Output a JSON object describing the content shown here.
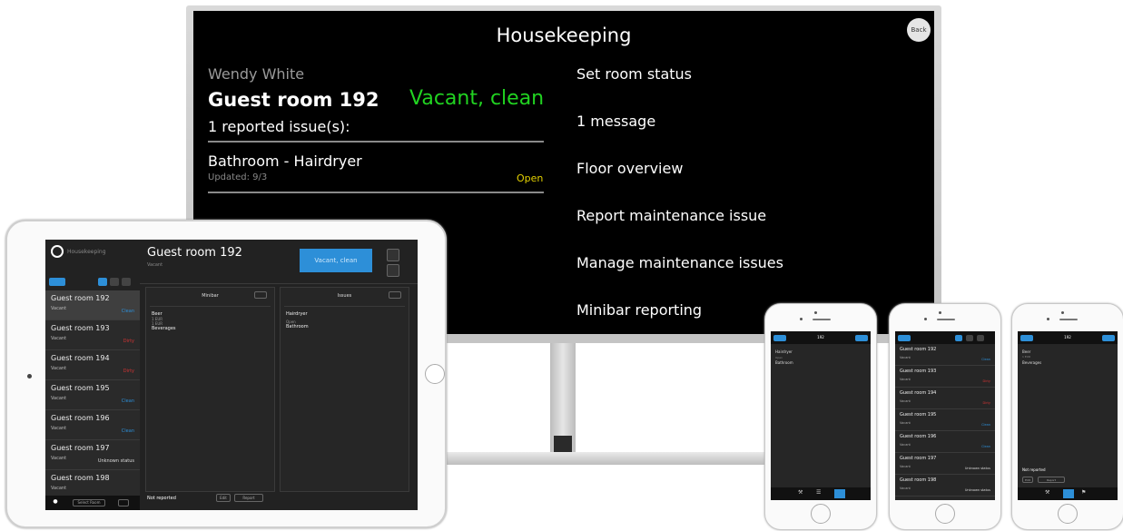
{
  "tv": {
    "title": "Housekeeping",
    "back_label": "Back",
    "staff_name": "Wendy White",
    "room": "Guest room 192",
    "room_status": "Vacant, clean",
    "issues_summary": "1 reported issue(s):",
    "issue": {
      "name": "Bathroom - Hairdryer",
      "updated": "Updated: 9/3",
      "state": "Open"
    },
    "menu": [
      "Set room status",
      "1 message",
      "Floor overview",
      "Report maintenance issue",
      "Manage maintenance issues",
      "Minibar reporting"
    ]
  },
  "ipad": {
    "app_name": "Housekeeping",
    "selected_room": "Guest room 192",
    "selected_room_state": "Vacant",
    "primary_action": "Vacant, clean",
    "rooms": [
      {
        "name": "Guest room 192",
        "state": "Vacant",
        "badge": "Clean",
        "badge_color": "#2d8fd8"
      },
      {
        "name": "Guest room 193",
        "state": "Vacant",
        "badge": "Dirty",
        "badge_color": "#d33333"
      },
      {
        "name": "Guest room 194",
        "state": "Vacant",
        "badge": "Dirty",
        "badge_color": "#d33333"
      },
      {
        "name": "Guest room 195",
        "state": "Vacant",
        "badge": "Clean",
        "badge_color": "#2d8fd8"
      },
      {
        "name": "Guest room 196",
        "state": "Vacant",
        "badge": "Clean",
        "badge_color": "#2d8fd8"
      },
      {
        "name": "Guest room 197",
        "state": "Vacant",
        "badge": "Unknown status",
        "badge_color": "#dddddd"
      },
      {
        "name": "Guest room 198",
        "state": "Vacant",
        "badge": "",
        "badge_color": "#dddddd"
      }
    ],
    "minibar": {
      "header": "Minibar",
      "lines": [
        "Beer",
        "1 EUR",
        "1 EUR",
        "Beverages"
      ]
    },
    "issues": {
      "header": "Issues",
      "lines": [
        "Hairdryer",
        "Open",
        "Bathroom"
      ]
    },
    "footer": {
      "label": "Not reported",
      "btn1": "Edit",
      "btn2": "Report"
    },
    "bottom_bar": {
      "btn": "Select Room"
    }
  },
  "phones": {
    "phone1": {
      "title": "192",
      "lines": [
        "Hairdryer",
        "Open",
        "Bathroom"
      ]
    },
    "phone2": {
      "rows": [
        {
          "name": "Guest room 192",
          "state": "Vacant",
          "badge": "Clean",
          "badge_color": "#2d8fd8"
        },
        {
          "name": "Guest room 193",
          "state": "Vacant",
          "badge": "Dirty",
          "badge_color": "#d33333"
        },
        {
          "name": "Guest room 194",
          "state": "Vacant",
          "badge": "Dirty",
          "badge_color": "#d33333"
        },
        {
          "name": "Guest room 195",
          "state": "Vacant",
          "badge": "Clean",
          "badge_color": "#2d8fd8"
        },
        {
          "name": "Guest room 196",
          "state": "Vacant",
          "badge": "Clean",
          "badge_color": "#2d8fd8"
        },
        {
          "name": "Guest room 197",
          "state": "Vacant",
          "badge": "Unknown status",
          "badge_color": "#dddddd"
        },
        {
          "name": "Guest room 198",
          "state": "Vacant",
          "badge": "Unknown status",
          "badge_color": "#dddddd"
        }
      ]
    },
    "phone3": {
      "title": "192",
      "lines": [
        "Beer",
        "1 EUR",
        "Beverages"
      ],
      "footer": "Not reported",
      "btn1": "Edit",
      "btn2": "Report"
    }
  },
  "colors": {
    "accent": "#2d8fd8",
    "clean_green": "#21d321",
    "open_yellow": "#e3d000"
  }
}
